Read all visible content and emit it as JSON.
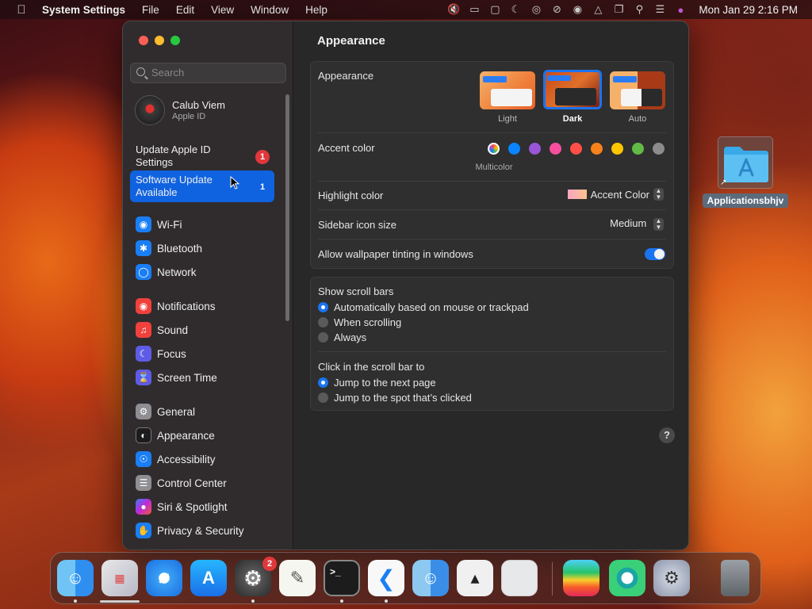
{
  "menubar": {
    "app": "System Settings",
    "menus": [
      "File",
      "Edit",
      "View",
      "Window",
      "Help"
    ],
    "clock": "Mon Jan 29  2:16 PM"
  },
  "sidebar": {
    "search_placeholder": "Search",
    "profile": {
      "name": "Calub Viem",
      "sub": "Apple ID"
    },
    "notices": [
      {
        "label": "Update Apple ID Settings",
        "badge": "1"
      },
      {
        "label": "Software Update Available",
        "badge": "1"
      }
    ],
    "items": [
      {
        "label": "Wi-Fi",
        "color": "#1a7ef5",
        "icon": "wifi-icon"
      },
      {
        "label": "Bluetooth",
        "color": "#1a7ef5",
        "icon": "bluetooth-icon"
      },
      {
        "label": "Network",
        "color": "#1a7ef5",
        "icon": "globe-icon"
      },
      {
        "label": "Notifications",
        "color": "#f0413c",
        "icon": "bell-icon"
      },
      {
        "label": "Sound",
        "color": "#f0413c",
        "icon": "speaker-icon"
      },
      {
        "label": "Focus",
        "color": "#5e5ce6",
        "icon": "moon-icon"
      },
      {
        "label": "Screen Time",
        "color": "#5e5ce6",
        "icon": "hourglass-icon"
      },
      {
        "label": "General",
        "color": "#8e8e93",
        "icon": "gear-icon"
      },
      {
        "label": "Appearance",
        "color": "#1c1c1e",
        "icon": "appearance-icon"
      },
      {
        "label": "Accessibility",
        "color": "#1a7ef5",
        "icon": "accessibility-icon"
      },
      {
        "label": "Control Center",
        "color": "#8e8e93",
        "icon": "toggles-icon"
      },
      {
        "label": "Siri & Spotlight",
        "color": "#c02ad8",
        "icon": "siri-icon"
      },
      {
        "label": "Privacy & Security",
        "color": "#1a7ef5",
        "icon": "hand-icon"
      }
    ]
  },
  "content": {
    "title": "Appearance",
    "appearance": {
      "label": "Appearance",
      "options": [
        "Light",
        "Dark",
        "Auto"
      ],
      "selected": "Dark"
    },
    "accent": {
      "label": "Accent color",
      "caption": "Multicolor",
      "colors": [
        "#ff9f0a",
        "#0a84ff",
        "#9a55d8",
        "#f74f9e",
        "#ff4f48",
        "#f7821b",
        "#ffc600",
        "#62ba46",
        "#8c8c8c"
      ]
    },
    "highlight": {
      "label": "Highlight color",
      "value": "Accent Color"
    },
    "icon_size": {
      "label": "Sidebar icon size",
      "value": "Medium"
    },
    "tinting": {
      "label": "Allow wallpaper tinting in windows",
      "on": true
    },
    "scroll": {
      "label": "Show scroll bars",
      "options": [
        "Automatically based on mouse or trackpad",
        "When scrolling",
        "Always"
      ],
      "selected": 0
    },
    "click": {
      "label": "Click in the scroll bar to",
      "options": [
        "Jump to the next page",
        "Jump to the spot that’s clicked"
      ],
      "selected": 0
    },
    "help": "?"
  },
  "desktop": {
    "icon_label": "Applicationsbhjv"
  },
  "dock": {
    "settings_badge": "2",
    "terminal_prompt": ">_"
  }
}
